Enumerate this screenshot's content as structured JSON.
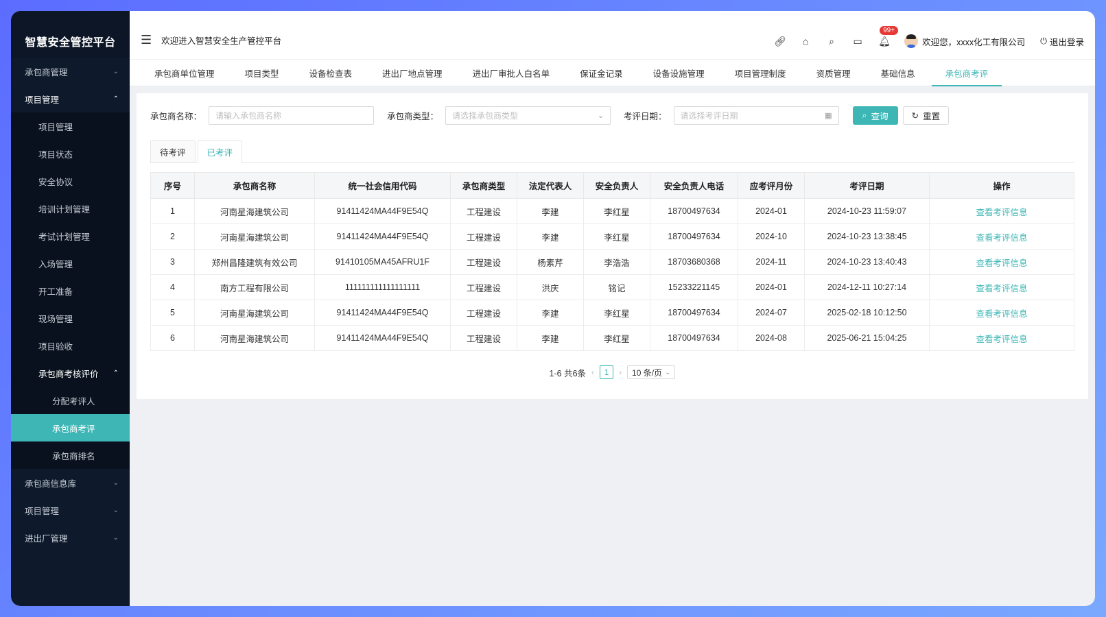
{
  "sidebar": {
    "brand": "智慧安全管控平台",
    "menu": [
      {
        "label": "承包商管理"
      },
      {
        "label": "项目管理"
      }
    ],
    "project_sub": [
      {
        "label": "项目管理"
      },
      {
        "label": "项目状态"
      },
      {
        "label": "安全协议"
      },
      {
        "label": "培训计划管理"
      },
      {
        "label": "考试计划管理"
      },
      {
        "label": "入场管理"
      },
      {
        "label": "开工准备"
      },
      {
        "label": "现场管理"
      },
      {
        "label": "项目验收"
      },
      {
        "label": "承包商考核评价"
      }
    ],
    "eval_sub": [
      {
        "label": "分配考评人"
      },
      {
        "label": "承包商考评"
      },
      {
        "label": "承包商排名"
      }
    ],
    "bottom_menu": [
      {
        "label": "承包商信息库"
      },
      {
        "label": "项目管理"
      },
      {
        "label": "进出厂管理"
      }
    ]
  },
  "header": {
    "welcome": "欢迎进入智慧安全生产管控平台",
    "badge": "99+",
    "user_greeting": "欢迎您，xxxx化工有限公司",
    "logout": "退出登录"
  },
  "navtabs": [
    "承包商单位管理",
    "项目类型",
    "设备检查表",
    "进出厂地点管理",
    "进出厂审批人白名单",
    "保证金记录",
    "设备设施管理",
    "项目管理制度",
    "资质管理",
    "基础信息",
    "承包商考评"
  ],
  "filters": {
    "name_label": "承包商名称：",
    "name_placeholder": "请输入承包商名称",
    "type_label": "承包商类型：",
    "type_placeholder": "请选择承包商类型",
    "date_label": "考评日期：",
    "date_placeholder": "请选择考评日期",
    "search_btn": "查询",
    "reset_btn": "重置"
  },
  "subtabs": [
    "待考评",
    "已考评"
  ],
  "table": {
    "headers": [
      "序号",
      "承包商名称",
      "统一社会信用代码",
      "承包商类型",
      "法定代表人",
      "安全负责人",
      "安全负责人电话",
      "应考评月份",
      "考评日期",
      "操作"
    ],
    "rows": [
      [
        "1",
        "河南星海建筑公司",
        "91411424MA44F9E54Q",
        "工程建设",
        "李建",
        "李红星",
        "18700497634",
        "2024-01",
        "2024-10-23 11:59:07",
        "查看考评信息"
      ],
      [
        "2",
        "河南星海建筑公司",
        "91411424MA44F9E54Q",
        "工程建设",
        "李建",
        "李红星",
        "18700497634",
        "2024-10",
        "2024-10-23 13:38:45",
        "查看考评信息"
      ],
      [
        "3",
        "郑州昌隆建筑有效公司",
        "91410105MA45AFRU1F",
        "工程建设",
        "杨素芹",
        "李浩浩",
        "18703680368",
        "2024-11",
        "2024-10-23 13:40:43",
        "查看考评信息"
      ],
      [
        "4",
        "南方工程有限公司",
        "111111111111111111",
        "工程建设",
        "洪庆",
        "铭记",
        "15233221145",
        "2024-01",
        "2024-12-11 10:27:14",
        "查看考评信息"
      ],
      [
        "5",
        "河南星海建筑公司",
        "91411424MA44F9E54Q",
        "工程建设",
        "李建",
        "李红星",
        "18700497634",
        "2024-07",
        "2025-02-18 10:12:50",
        "查看考评信息"
      ],
      [
        "6",
        "河南星海建筑公司",
        "91411424MA44F9E54Q",
        "工程建设",
        "李建",
        "李红星",
        "18700497634",
        "2024-08",
        "2025-06-21 15:04:25",
        "查看考评信息"
      ]
    ]
  },
  "pager": {
    "summary": "1-6 共6条",
    "page": "1",
    "size": "10 条/页"
  },
  "colors": {
    "accent": "#3eb6b6",
    "sidebar_bg": "#0e1a2b"
  }
}
